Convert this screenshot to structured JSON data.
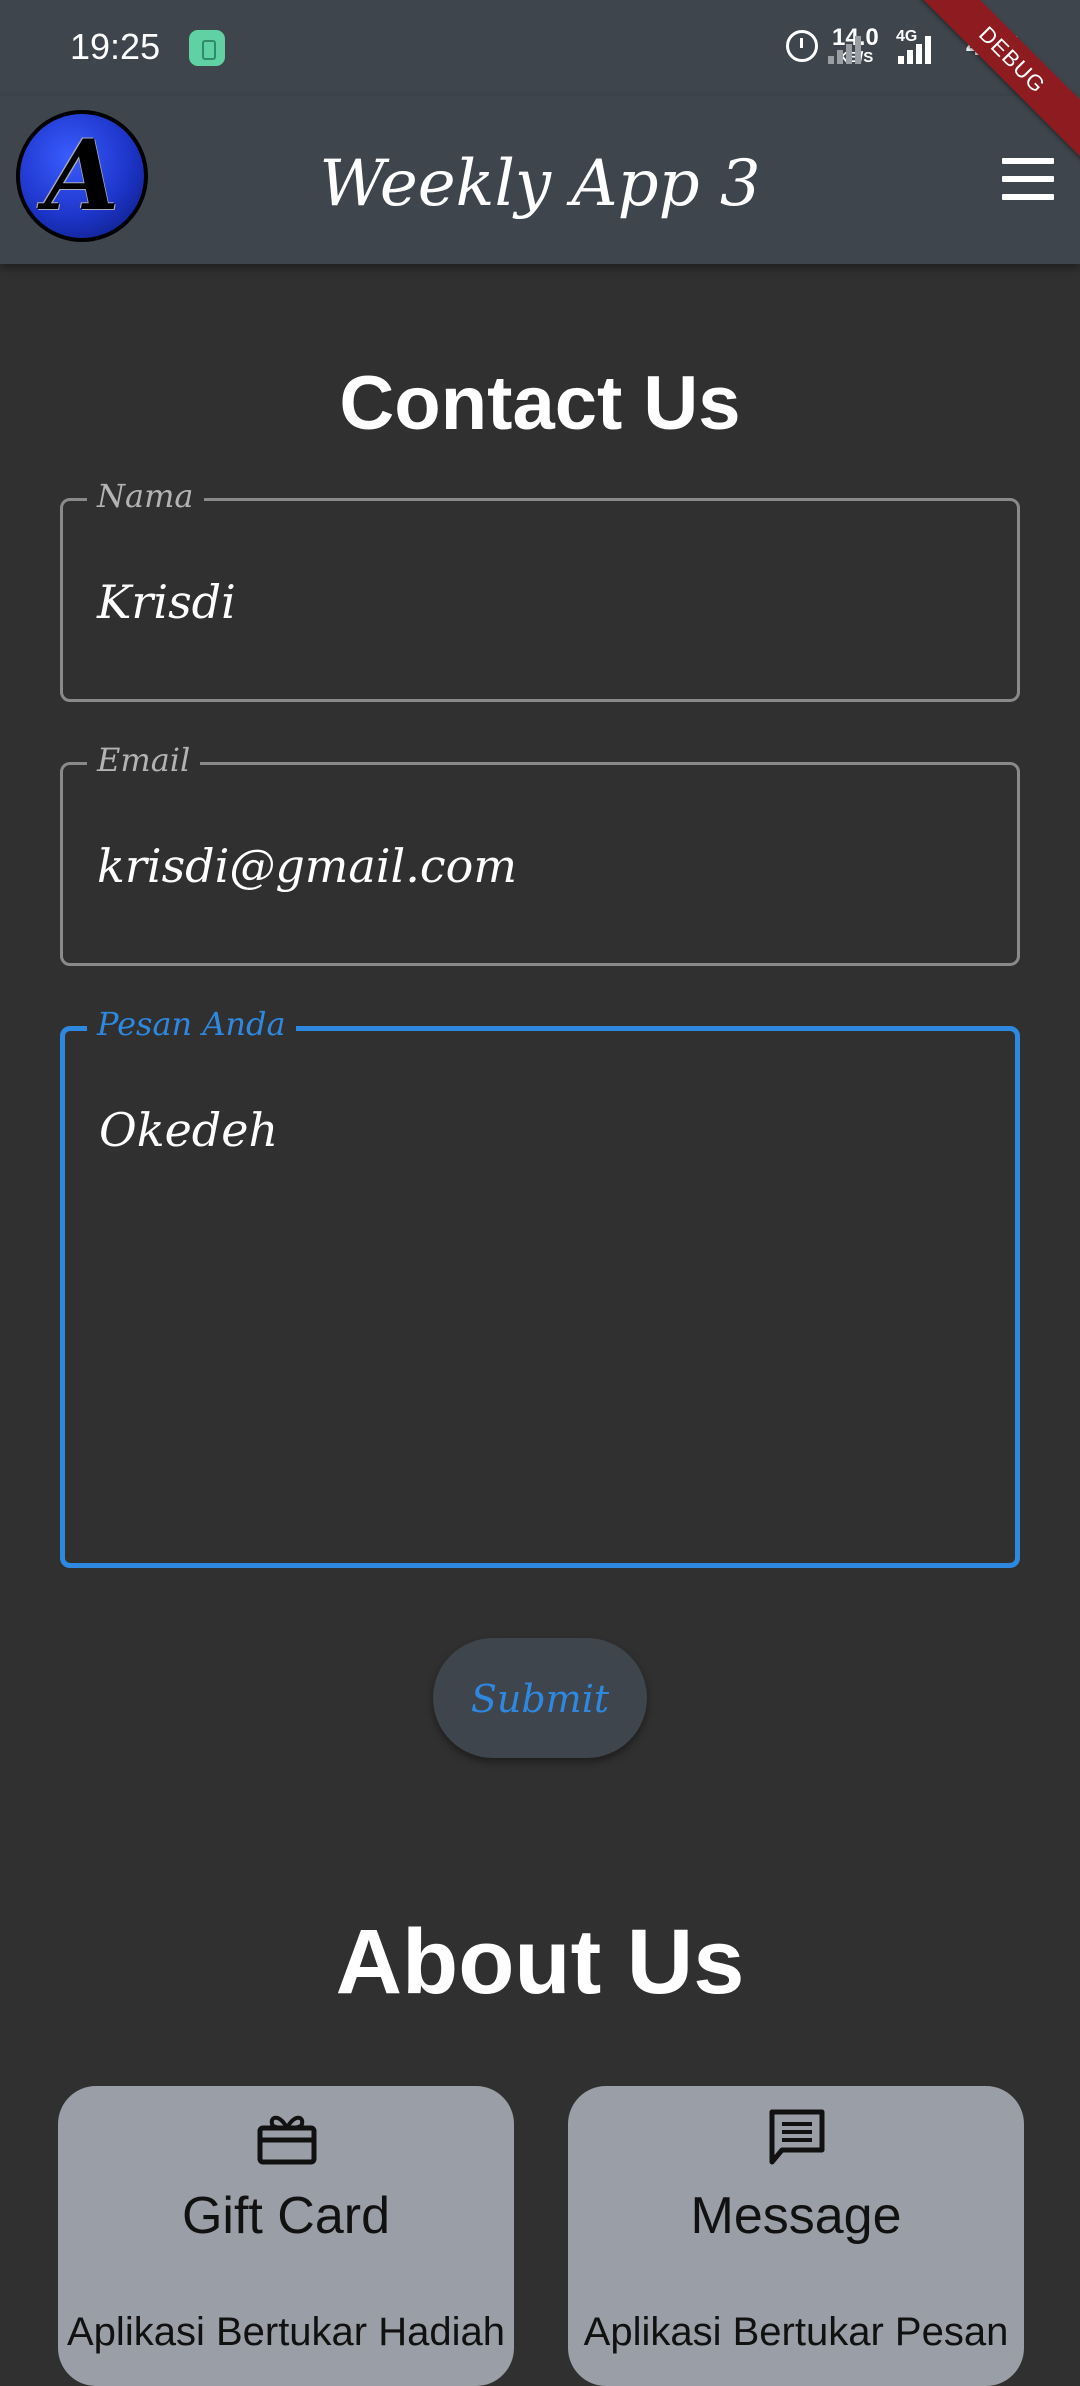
{
  "status_bar": {
    "time": "19:25",
    "net_speed_value": "14.0",
    "net_speed_unit": "KB/S",
    "network_type": "4G",
    "battery": "41%",
    "debug_label": "DEBUG"
  },
  "app_bar": {
    "title": "Weekly App 3",
    "logo_letter": "A"
  },
  "contact": {
    "title": "Contact Us",
    "fields": [
      {
        "label": "Nama",
        "value": "Krisdi"
      },
      {
        "label": "Email",
        "value": "krisdi@gmail.com"
      },
      {
        "label": "Pesan Anda",
        "value": "Okedeh"
      }
    ],
    "submit_label": "Submit"
  },
  "about": {
    "title": "About Us",
    "cards": [
      {
        "icon": "gift-card-icon",
        "title": "Gift Card",
        "description": "Aplikasi Bertukar Hadiah"
      },
      {
        "icon": "message-icon",
        "title": "Message",
        "description": "Aplikasi Bertukar Pesan"
      }
    ]
  },
  "colors": {
    "background": "#303030",
    "app_bar": "#3e454c",
    "accent": "#2e88e0",
    "card": "#9a9ea6",
    "debug_banner": "#8e1b1f"
  }
}
